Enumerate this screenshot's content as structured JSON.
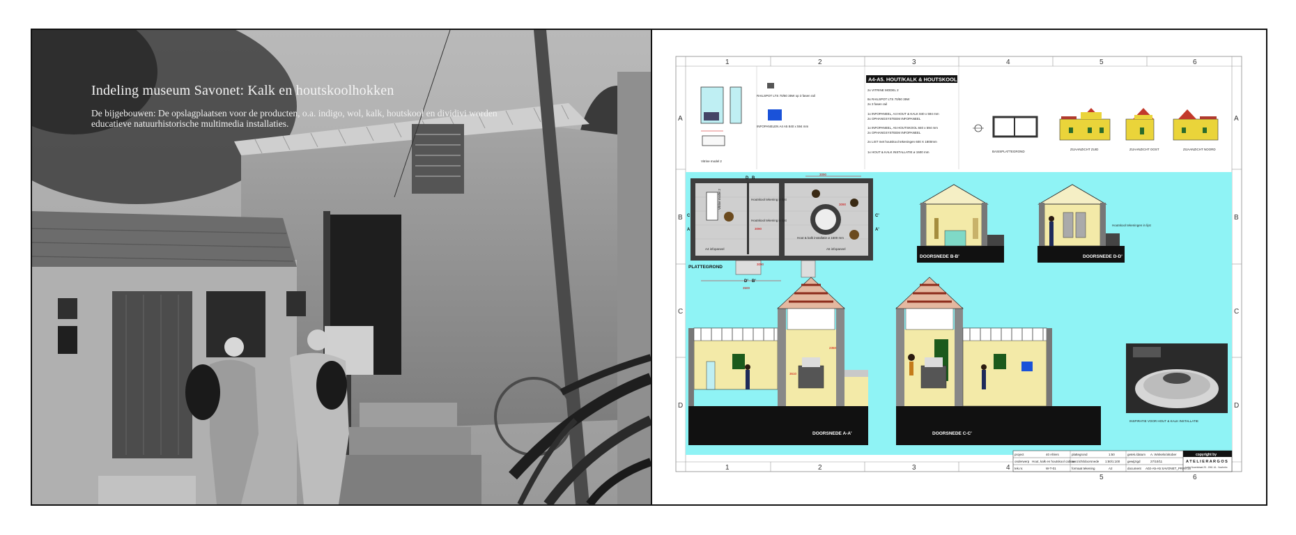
{
  "left_panel": {
    "title": "Indeling museum Savonet: Kalk en houtskoolhokken",
    "caption": "De bijgebouwen:  De opslagplaatsen voor de producten, o.a. indigo, wol, kalk, houtskool en dividivi worden educatieve natuurhistorische multimedia installaties."
  },
  "drawing": {
    "header_title": "A4-A5. HOUT/KALK & HOUTSKOOL",
    "columns": [
      "1",
      "2",
      "3",
      "4",
      "5",
      "6"
    ],
    "rows": [
      "A",
      "B",
      "C",
      "D"
    ],
    "legend_items": [
      "2x  VITRINE MODEL 2",
      "8x  RAILSPOT LTS 70/50 35W",
      "2x  3 fasen rail",
      "1x  INFOPANEEL, A4 HOUT & KALK 840 x 594 mm",
      "2x  OPHANGSYSTEEM INFOPANEEL",
      "1x  INFOPANEEL, A5 HOUTSKOOL 840 x 594 mm",
      "2x  OPHANGSYSTEEM INFOPANEEL",
      "2x  LIST met houtskool tekeningen 600 X 1800mm",
      "1x  HOUT & KALK INSTALLATIE ø 1500 mm"
    ],
    "top_labels": {
      "vitrine": "Vitrine model 2",
      "railspot": "RAILSPOT LTS 70/50 35W op 3 fasen rail",
      "infopanelen": "INFOPANELEN A4 A5 840 x 594 mm",
      "basisplattegrond": "BASISPLATTEGROND",
      "zuid": "ZIJAANZICHT ZUID",
      "oost": "ZIJAANZICHT OOST",
      "noord": "ZIJAANZICHT NOORD"
    },
    "plan_labels": {
      "plattegrond": "PLATTEGROND",
      "vitrine": "Vitrine model 2",
      "tekening1": "Houtskool tekening in lijst",
      "tekening2": "Houtskool tekening in lijst",
      "installatie": "Hout & kalk installatie ø 1500 mm",
      "info_a4": "A4 infopaneel",
      "info_a5": "A5 infopaneel",
      "dim1": "3090",
      "dim2": "3090",
      "dim3": "3500",
      "dim4": "3090",
      "dim5": "3090",
      "B": "B",
      "D": "D",
      "B2": "B'",
      "D2": "D'",
      "C": "C",
      "A": "A",
      "C2": "C'",
      "A2": "A'"
    },
    "sections": {
      "bb": "DOORSNEDE B-B'",
      "dd": "DOORSNEDE D-D'",
      "aa": "DOORSNEDE A-A'",
      "cc": "DOORSNEDE C-C'",
      "dd_note": "Houtskool tekeningen in lijst",
      "aa_dim1": "2350",
      "aa_dim2": "3610"
    },
    "inspiration_caption": "INSPIRATIE VOOR HOUT & KALK INSTALLATIE",
    "title_block": {
      "r1": [
        "project",
        "40 Ahlers",
        "plattegrond",
        "1:50",
        "getek./datum",
        "A. Winkels/oktober"
      ],
      "r2": [
        "onderwerp",
        "Hout, kalk en houtskool cabine",
        "aanzicht/doorsnede",
        "1:50/1:100",
        "gewijzigd",
        "27/10/11"
      ],
      "r3": [
        "tek.nr.",
        "W-T-01",
        "formaat tekening",
        "A2",
        "document",
        "A02-A5-A5 SAVONET_PRINT.ai"
      ],
      "copyright": "copyright by",
      "firm": "A T E L I E R   A R G O S",
      "firm_sub": "J. Van Noordstraat 25 - 1961 JA - Voorhelm"
    }
  }
}
